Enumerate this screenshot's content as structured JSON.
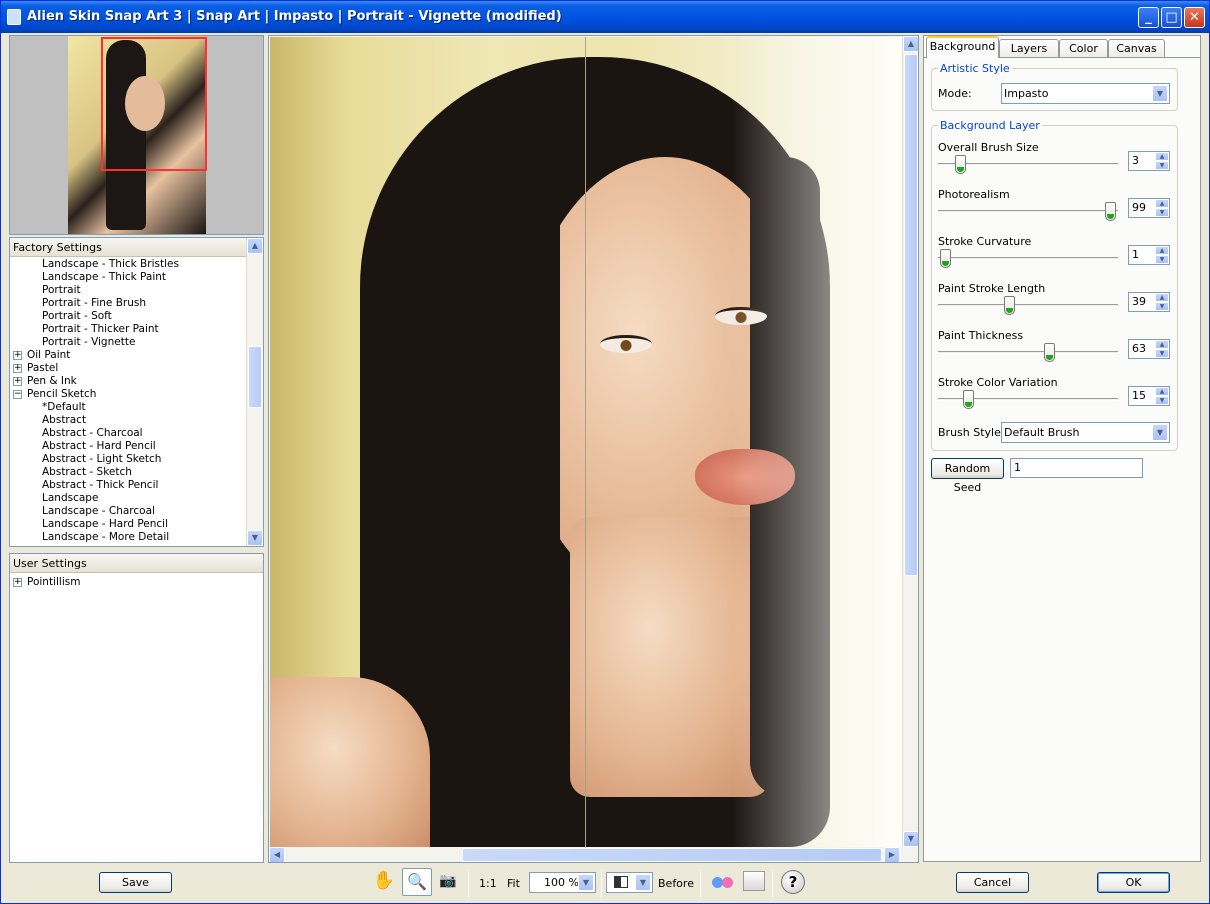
{
  "window": {
    "title": "Alien Skin Snap Art 3 | Snap Art | Impasto | Portrait - Vignette (modified)",
    "minimize": "_",
    "maximize": "□",
    "close": "✕"
  },
  "factory": {
    "header": "Factory Settings",
    "items": [
      {
        "label": "Landscape - Thick Bristles",
        "level": 2,
        "expander": ""
      },
      {
        "label": "Landscape - Thick Paint",
        "level": 2,
        "expander": ""
      },
      {
        "label": "Portrait",
        "level": 2,
        "expander": ""
      },
      {
        "label": "Portrait - Fine Brush",
        "level": 2,
        "expander": ""
      },
      {
        "label": "Portrait - Soft",
        "level": 2,
        "expander": ""
      },
      {
        "label": "Portrait - Thicker Paint",
        "level": 2,
        "expander": ""
      },
      {
        "label": "Portrait - Vignette",
        "level": 2,
        "expander": ""
      },
      {
        "label": "Oil Paint",
        "level": 1,
        "expander": "+"
      },
      {
        "label": "Pastel",
        "level": 1,
        "expander": "+"
      },
      {
        "label": "Pen & Ink",
        "level": 1,
        "expander": "+"
      },
      {
        "label": "Pencil Sketch",
        "level": 1,
        "expander": "−"
      },
      {
        "label": "*Default",
        "level": 2,
        "expander": ""
      },
      {
        "label": "Abstract",
        "level": 2,
        "expander": ""
      },
      {
        "label": "Abstract - Charcoal",
        "level": 2,
        "expander": ""
      },
      {
        "label": "Abstract - Hard Pencil",
        "level": 2,
        "expander": ""
      },
      {
        "label": "Abstract - Light Sketch",
        "level": 2,
        "expander": ""
      },
      {
        "label": "Abstract - Sketch",
        "level": 2,
        "expander": ""
      },
      {
        "label": "Abstract - Thick Pencil",
        "level": 2,
        "expander": ""
      },
      {
        "label": "Landscape",
        "level": 2,
        "expander": ""
      },
      {
        "label": "Landscape - Charcoal",
        "level": 2,
        "expander": ""
      },
      {
        "label": "Landscape - Hard Pencil",
        "level": 2,
        "expander": ""
      },
      {
        "label": "Landscape - More Detail",
        "level": 2,
        "expander": ""
      }
    ]
  },
  "user": {
    "header": "User Settings",
    "items": [
      {
        "label": "Pointillism",
        "expander": "+"
      }
    ]
  },
  "tabs": [
    "Background",
    "Layers",
    "Color",
    "Canvas"
  ],
  "artistic": {
    "title": "Artistic Style",
    "mode_label": "Mode:",
    "mode_value": "Impasto"
  },
  "background_layer": {
    "title": "Background Layer",
    "sliders": [
      {
        "label": "Overall Brush Size",
        "value": "3",
        "fraction": 0.1
      },
      {
        "label": "Photorealism",
        "value": "99",
        "fraction": 0.99
      },
      {
        "label": "Stroke Curvature",
        "value": "1",
        "fraction": 0.01
      },
      {
        "label": "Paint Stroke Length",
        "value": "39",
        "fraction": 0.39
      },
      {
        "label": "Paint Thickness",
        "value": "63",
        "fraction": 0.63
      },
      {
        "label": "Stroke Color Variation",
        "value": "15",
        "fraction": 0.15
      }
    ],
    "brush_style_label": "Brush Style",
    "brush_style_value": "Default Brush"
  },
  "random_seed": {
    "label": "Random Seed",
    "value": "1"
  },
  "bottom": {
    "save": "Save",
    "one_to_one": "1:1",
    "fit": "Fit",
    "zoom": "100 %",
    "before": "Before",
    "cancel": "Cancel",
    "ok": "OK"
  },
  "icons": {
    "hand": "✋",
    "zoom": "🔍",
    "camera": "📷",
    "help": "?"
  }
}
